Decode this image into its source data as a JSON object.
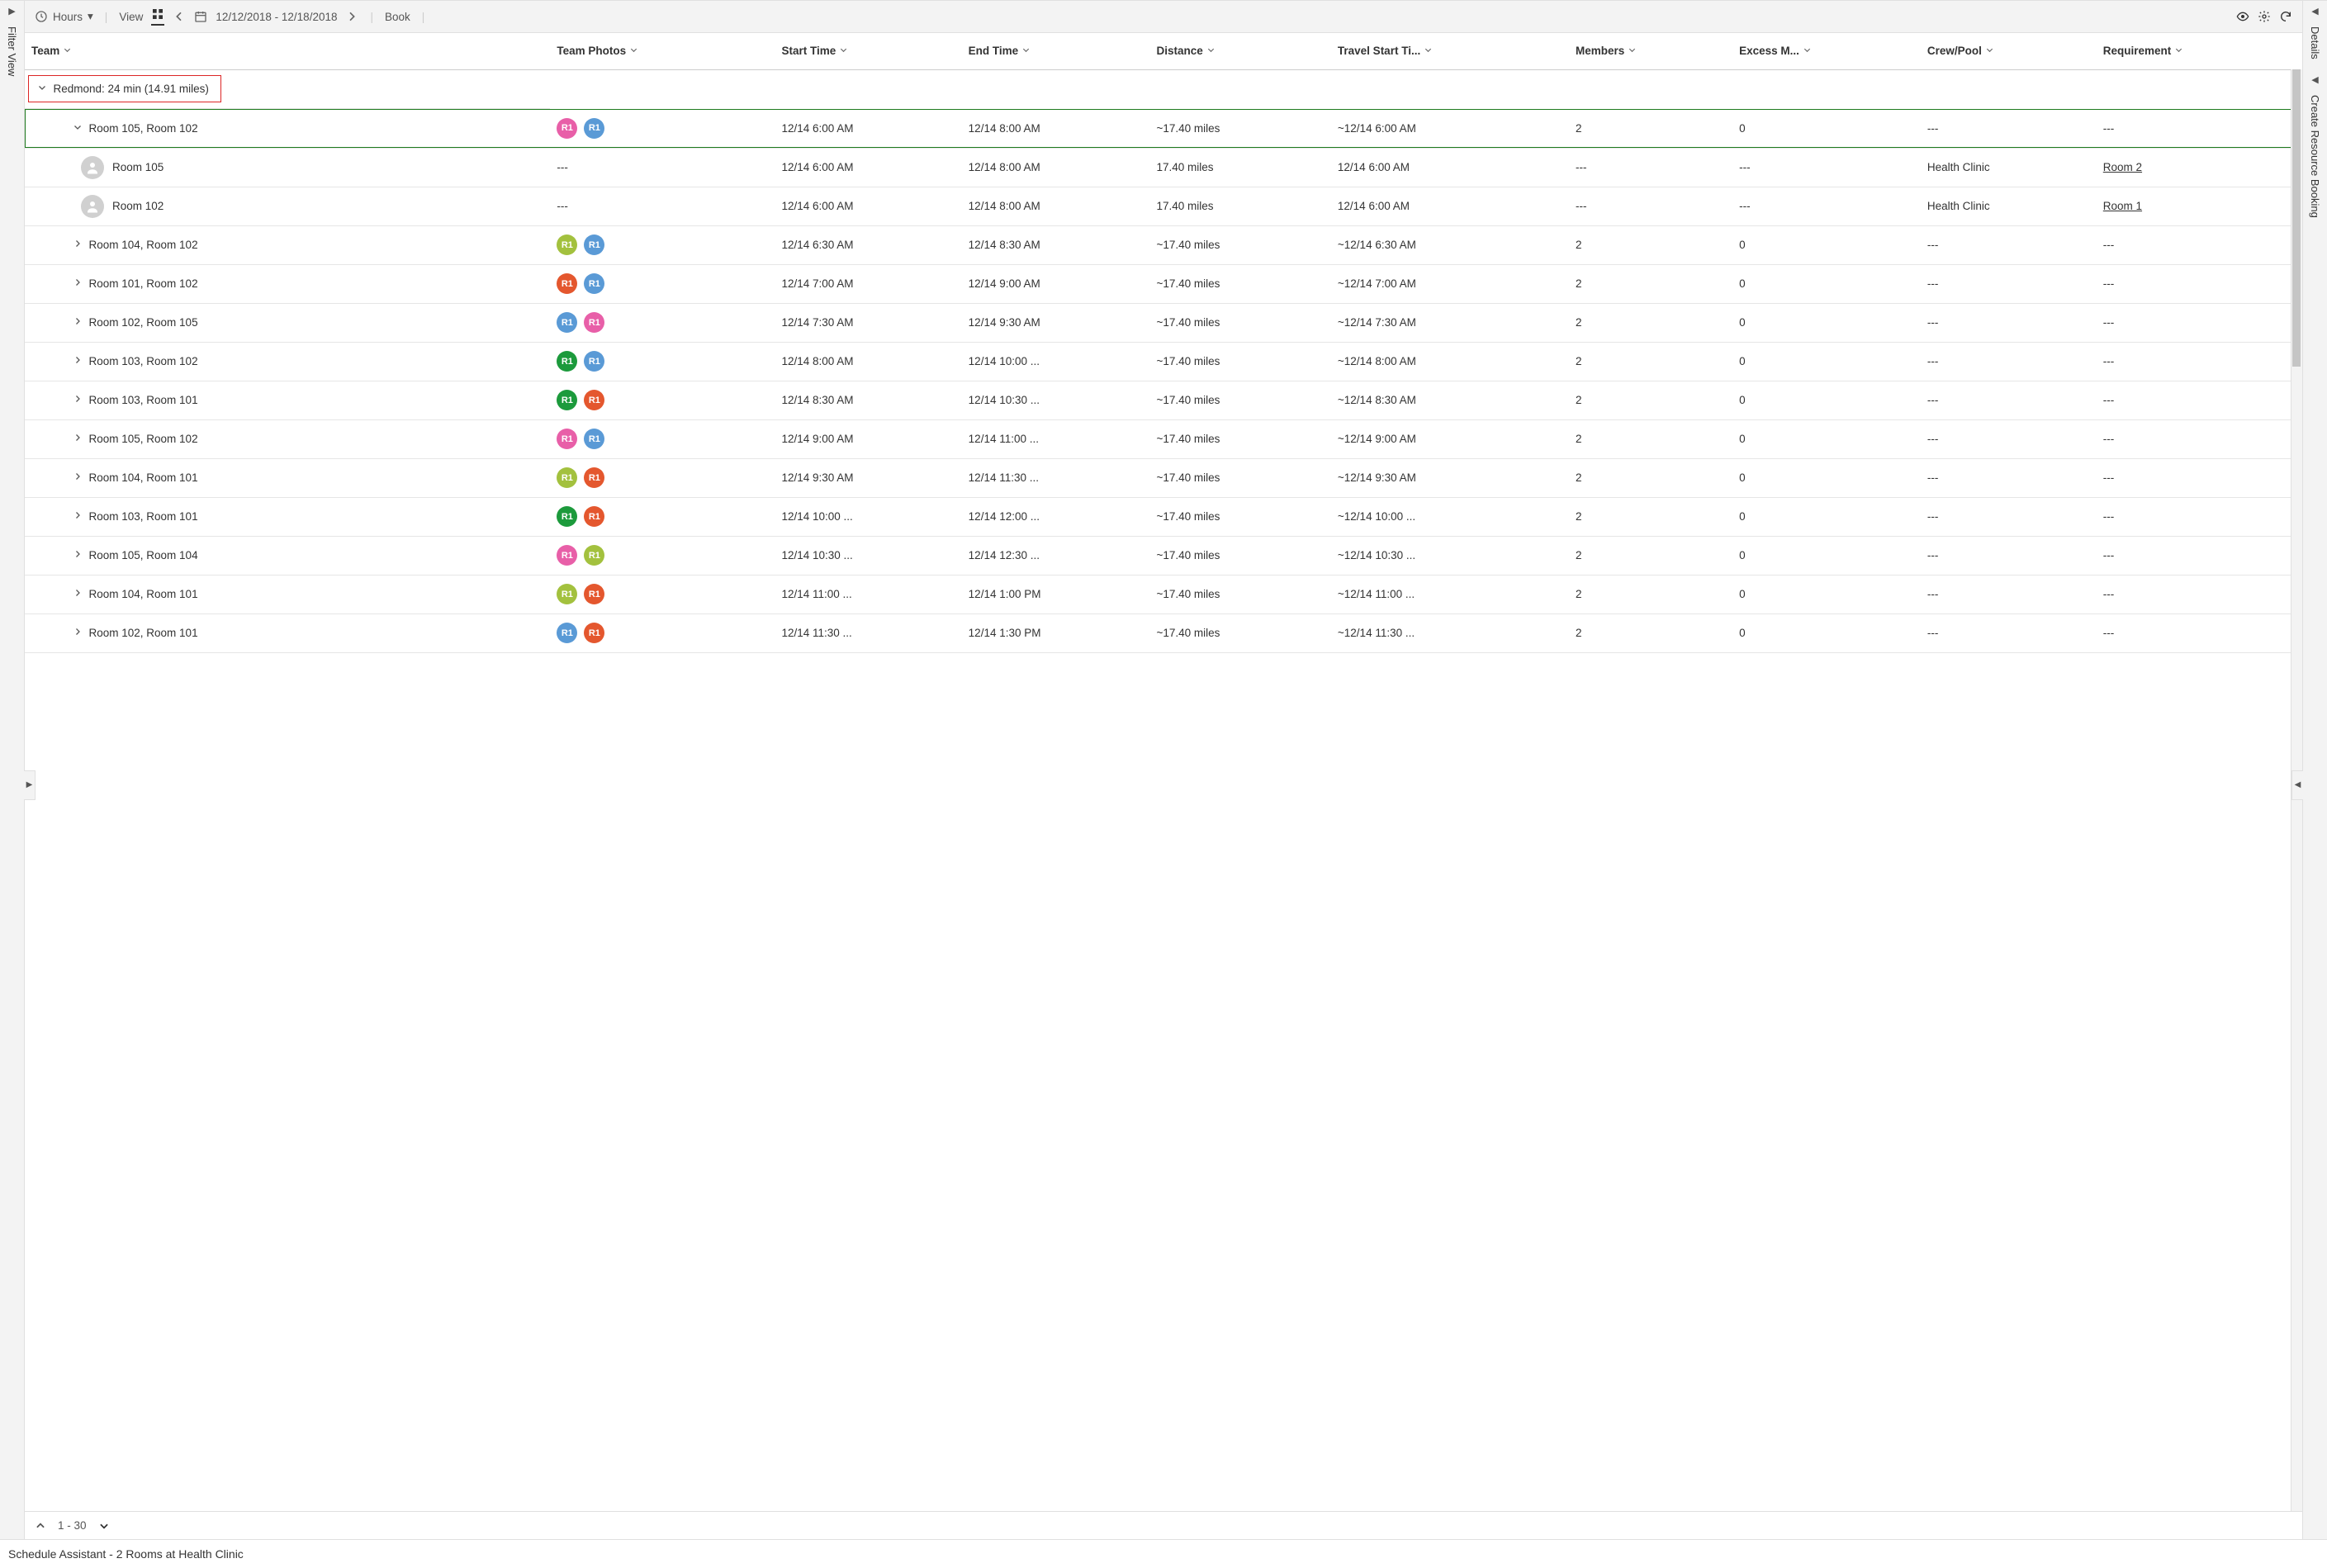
{
  "toolbar": {
    "hours_label": "Hours",
    "view_label": "View",
    "date_range": "12/12/2018 - 12/18/2018",
    "book_label": "Book"
  },
  "leftRail": {
    "label": "Filter View"
  },
  "rightRail": {
    "label1": "Details",
    "label2": "Create Resource Booking"
  },
  "columns": {
    "team": "Team",
    "photos": "Team Photos",
    "start": "Start Time",
    "end": "End Time",
    "distance": "Distance",
    "travel": "Travel Start Ti...",
    "members": "Members",
    "excess": "Excess M...",
    "crew": "Crew/Pool",
    "req": "Requirement"
  },
  "group": {
    "label": "Redmond: 24 min (14.91 miles)"
  },
  "colors": {
    "pink": "#e85fa8",
    "blue": "#5a9ad6",
    "olive": "#a3c13e",
    "red": "#e4572e",
    "green": "#1c9a3c",
    "darkgreen": "#2e7d32"
  },
  "rows": [
    {
      "type": "team-expanded",
      "label": "Room 105, Room 102",
      "badges": [
        "pink",
        "blue"
      ],
      "photos": "",
      "start": "12/14 6:00 AM",
      "end": "12/14 8:00 AM",
      "dist": "~17.40 miles",
      "travel": "~12/14 6:00 AM",
      "members": "2",
      "excess": "0",
      "crew": "---",
      "req": "---",
      "highlight": true
    },
    {
      "type": "resource",
      "label": "Room 105",
      "photos": "---",
      "start": "12/14 6:00 AM",
      "end": "12/14 8:00 AM",
      "dist": "17.40 miles",
      "travel": "12/14 6:00 AM",
      "members": "---",
      "excess": "---",
      "crew": "Health Clinic",
      "req": "Room 2",
      "reqLink": true
    },
    {
      "type": "resource",
      "label": "Room 102",
      "photos": "---",
      "start": "12/14 6:00 AM",
      "end": "12/14 8:00 AM",
      "dist": "17.40 miles",
      "travel": "12/14 6:00 AM",
      "members": "---",
      "excess": "---",
      "crew": "Health Clinic",
      "req": "Room 1",
      "reqLink": true
    },
    {
      "type": "team",
      "label": "Room 104, Room 102",
      "badges": [
        "olive",
        "blue"
      ],
      "start": "12/14 6:30 AM",
      "end": "12/14 8:30 AM",
      "dist": "~17.40 miles",
      "travel": "~12/14 6:30 AM",
      "members": "2",
      "excess": "0",
      "crew": "---",
      "req": "---"
    },
    {
      "type": "team",
      "label": "Room 101, Room 102",
      "badges": [
        "red",
        "blue"
      ],
      "start": "12/14 7:00 AM",
      "end": "12/14 9:00 AM",
      "dist": "~17.40 miles",
      "travel": "~12/14 7:00 AM",
      "members": "2",
      "excess": "0",
      "crew": "---",
      "req": "---"
    },
    {
      "type": "team",
      "label": "Room 102, Room 105",
      "badges": [
        "blue",
        "pink"
      ],
      "start": "12/14 7:30 AM",
      "end": "12/14 9:30 AM",
      "dist": "~17.40 miles",
      "travel": "~12/14 7:30 AM",
      "members": "2",
      "excess": "0",
      "crew": "---",
      "req": "---"
    },
    {
      "type": "team",
      "label": "Room 103, Room 102",
      "badges": [
        "green",
        "blue"
      ],
      "start": "12/14 8:00 AM",
      "end": "12/14 10:00 ...",
      "dist": "~17.40 miles",
      "travel": "~12/14 8:00 AM",
      "members": "2",
      "excess": "0",
      "crew": "---",
      "req": "---"
    },
    {
      "type": "team",
      "label": "Room 103, Room 101",
      "badges": [
        "green",
        "red"
      ],
      "start": "12/14 8:30 AM",
      "end": "12/14 10:30 ...",
      "dist": "~17.40 miles",
      "travel": "~12/14 8:30 AM",
      "members": "2",
      "excess": "0",
      "crew": "---",
      "req": "---"
    },
    {
      "type": "team",
      "label": "Room 105, Room 102",
      "badges": [
        "pink",
        "blue"
      ],
      "start": "12/14 9:00 AM",
      "end": "12/14 11:00 ...",
      "dist": "~17.40 miles",
      "travel": "~12/14 9:00 AM",
      "members": "2",
      "excess": "0",
      "crew": "---",
      "req": "---"
    },
    {
      "type": "team",
      "label": "Room 104, Room 101",
      "badges": [
        "olive",
        "red"
      ],
      "start": "12/14 9:30 AM",
      "end": "12/14 11:30 ...",
      "dist": "~17.40 miles",
      "travel": "~12/14 9:30 AM",
      "members": "2",
      "excess": "0",
      "crew": "---",
      "req": "---"
    },
    {
      "type": "team",
      "label": "Room 103, Room 101",
      "badges": [
        "green",
        "red"
      ],
      "start": "12/14 10:00 ...",
      "end": "12/14 12:00 ...",
      "dist": "~17.40 miles",
      "travel": "~12/14 10:00 ...",
      "members": "2",
      "excess": "0",
      "crew": "---",
      "req": "---"
    },
    {
      "type": "team",
      "label": "Room 105, Room 104",
      "badges": [
        "pink",
        "olive"
      ],
      "start": "12/14 10:30 ...",
      "end": "12/14 12:30 ...",
      "dist": "~17.40 miles",
      "travel": "~12/14 10:30 ...",
      "members": "2",
      "excess": "0",
      "crew": "---",
      "req": "---"
    },
    {
      "type": "team",
      "label": "Room 104, Room 101",
      "badges": [
        "olive",
        "red"
      ],
      "start": "12/14 11:00 ...",
      "end": "12/14 1:00 PM",
      "dist": "~17.40 miles",
      "travel": "~12/14 11:00 ...",
      "members": "2",
      "excess": "0",
      "crew": "---",
      "req": "---"
    },
    {
      "type": "team",
      "label": "Room 102, Room 101",
      "badges": [
        "blue",
        "red"
      ],
      "start": "12/14 11:30 ...",
      "end": "12/14 1:30 PM",
      "dist": "~17.40 miles",
      "travel": "~12/14 11:30 ...",
      "members": "2",
      "excess": "0",
      "crew": "---",
      "req": "---"
    }
  ],
  "pager": {
    "range": "1 - 30"
  },
  "footer": {
    "title": "Schedule Assistant - 2 Rooms at Health Clinic"
  }
}
